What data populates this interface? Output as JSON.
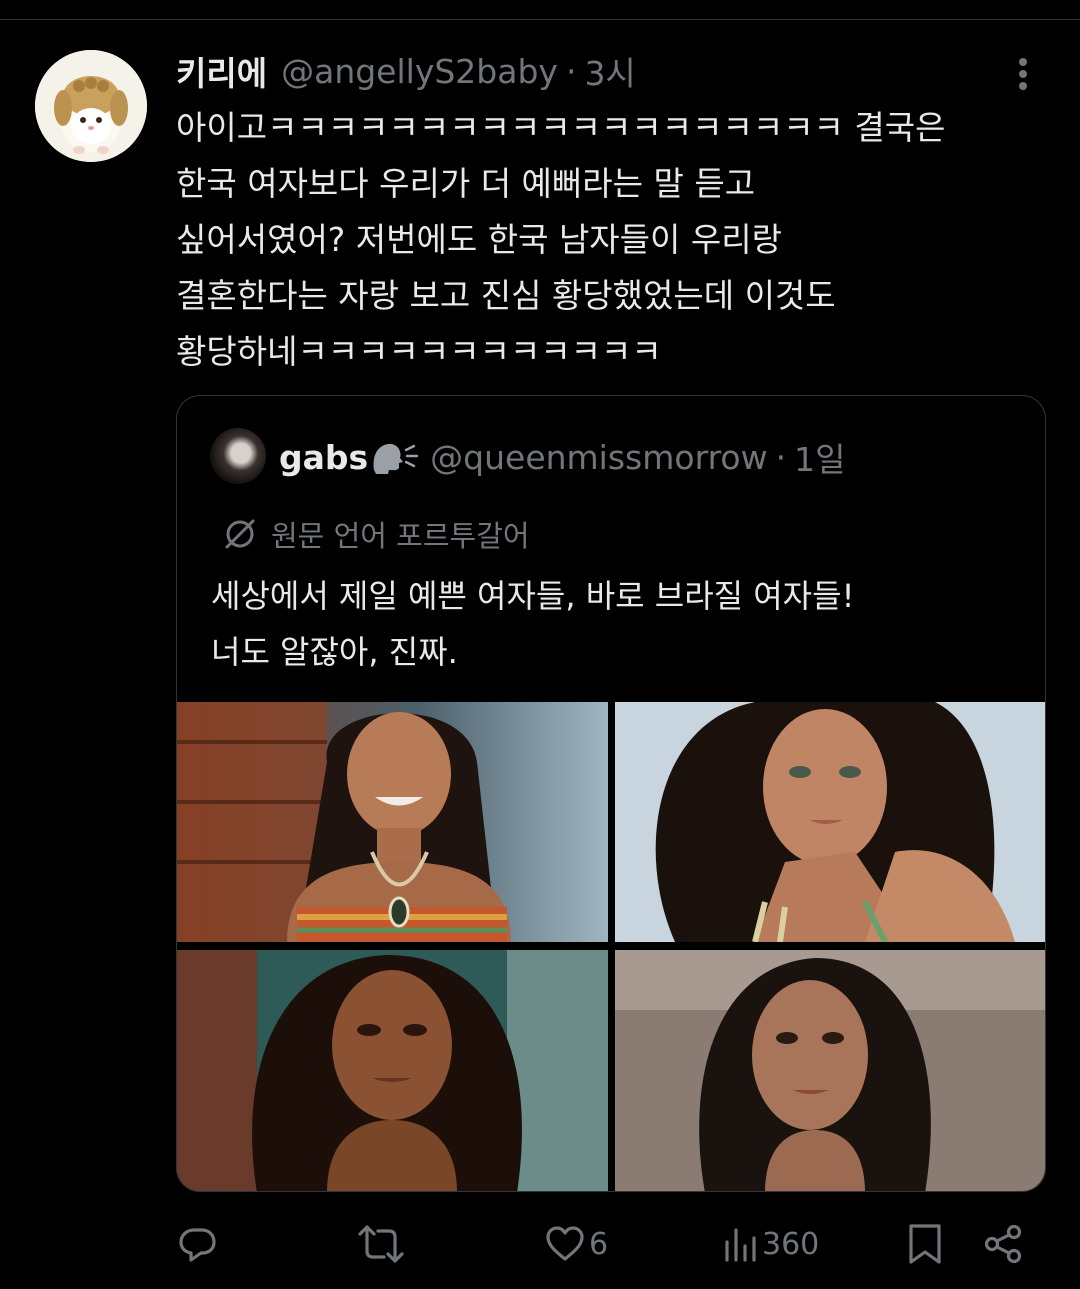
{
  "tweet": {
    "display_name": "키리에",
    "handle": "@angellyS2baby",
    "separator": "·",
    "time": "3시",
    "text_lines": [
      "아이고ㅋㅋㅋㅋㅋㅋㅋㅋㅋㅋㅋㅋㅋㅋㅋㅋㅋㅋㅋ 결국은",
      "한국 여자보다 우리가 더 예뻐라는 말 듣고",
      "싶어서였어? 저번에도 한국 남자들이 우리랑",
      "결혼한다는 자랑 보고 진심 황당했었는데 이것도",
      "황당하네ㅋㅋㅋㅋㅋㅋㅋㅋㅋㅋㅋㅋ"
    ]
  },
  "quote": {
    "display_name": "gabs",
    "handle": "@queenmissmorrow",
    "separator": "·",
    "time": "1일",
    "translate_label": "원문 언어 포르투갈어",
    "text_lines": [
      "세상에서 제일 예쁜 여자들, 바로 브라질 여자들!",
      "너도 알잖아, 진짜."
    ],
    "media_count": 4
  },
  "actions": {
    "reply_count": "",
    "retweet_count": "",
    "like_count": "6",
    "view_count": "360"
  },
  "icons": {
    "more": "more-dots-icon",
    "translate": "translate-globe-icon",
    "reply": "reply-icon",
    "retweet": "retweet-icon",
    "like": "heart-icon",
    "views": "views-chart-icon",
    "bookmark": "bookmark-icon",
    "share": "share-icon"
  },
  "colors": {
    "background": "#000000",
    "text_primary": "#e7e9ea",
    "text_secondary": "#71767b",
    "border": "#333639"
  }
}
